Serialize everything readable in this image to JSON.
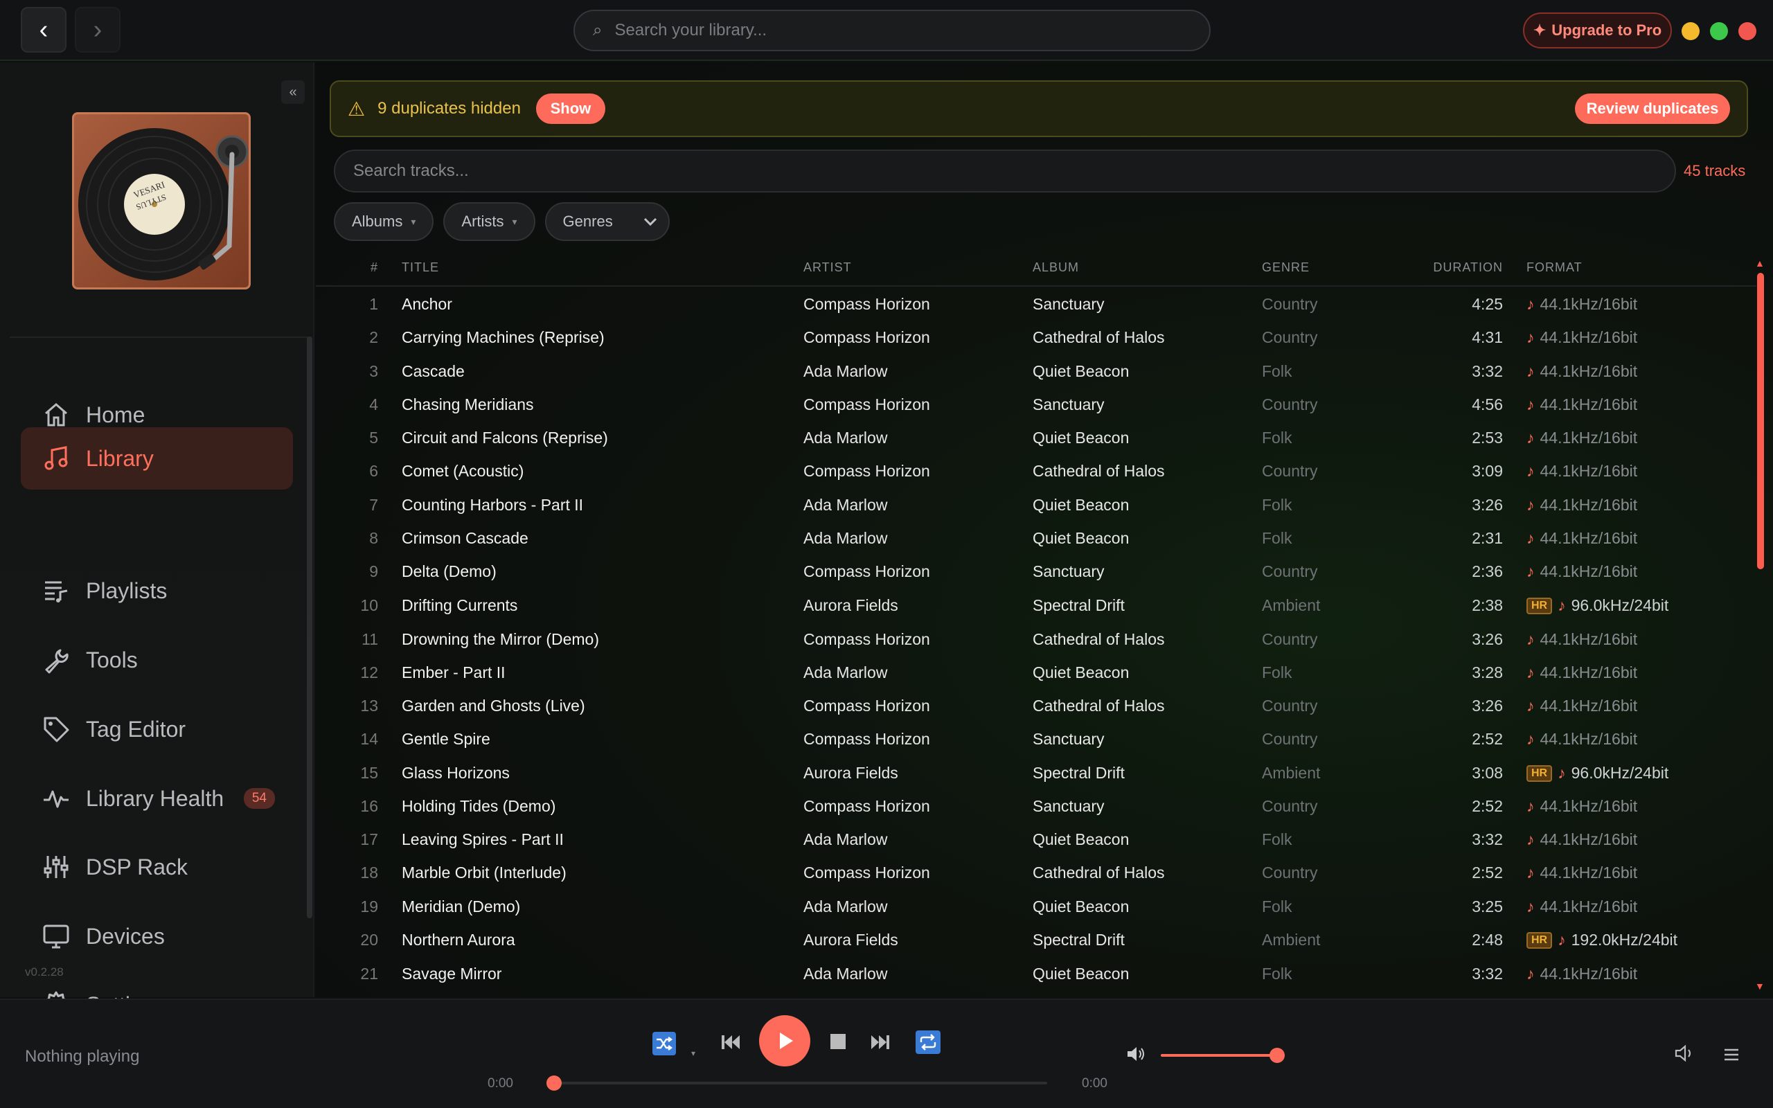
{
  "titlebar": {
    "search_placeholder": "Search your library...",
    "upgrade_label": "Upgrade to Pro"
  },
  "colors": {
    "accent": "#ff6b5b",
    "warning": "#e9c24a",
    "background": "#0e0f10"
  },
  "sidebar": {
    "collapse_label": "«",
    "art_label_top": "VESARI",
    "art_label_bottom": "STYLUS",
    "items": [
      {
        "label": "Home",
        "icon": "home-icon"
      },
      {
        "label": "Library",
        "icon": "music-note-icon",
        "active": true
      },
      {
        "label": "Playlists",
        "icon": "playlist-icon"
      },
      {
        "label": "Tools",
        "icon": "wrench-icon"
      },
      {
        "label": "Tag Editor",
        "icon": "tag-icon"
      },
      {
        "label": "Library Health",
        "icon": "pulse-icon",
        "badge": "54"
      },
      {
        "label": "DSP Rack",
        "icon": "sliders-icon"
      },
      {
        "label": "Devices",
        "icon": "monitor-icon"
      },
      {
        "label": "Settings",
        "icon": "gear-icon"
      }
    ],
    "version": "v0.2.28"
  },
  "duplicates": {
    "message": "9 duplicates hidden",
    "show_label": "Show",
    "review_label": "Review duplicates"
  },
  "tracks_search": {
    "placeholder": "Search tracks...",
    "count": "45 tracks"
  },
  "filters": [
    {
      "label": "Albums"
    },
    {
      "label": "Artists"
    },
    {
      "label": "Genres"
    }
  ],
  "table": {
    "columns": {
      "num": "#",
      "title": "TITLE",
      "artist": "ARTIST",
      "album": "ALBUM",
      "genre": "GENRE",
      "duration": "DURATION",
      "format": "FORMAT"
    },
    "rows": [
      {
        "num": "1",
        "title": "Anchor",
        "artist": "Compass Horizon",
        "album": "Sanctuary",
        "genre": "Country",
        "duration": "4:25",
        "format": "44.1kHz/16bit",
        "hr": false
      },
      {
        "num": "2",
        "title": "Carrying Machines (Reprise)",
        "artist": "Compass Horizon",
        "album": "Cathedral of Halos",
        "genre": "Country",
        "duration": "4:31",
        "format": "44.1kHz/16bit",
        "hr": false
      },
      {
        "num": "3",
        "title": "Cascade",
        "artist": "Ada Marlow",
        "album": "Quiet Beacon",
        "genre": "Folk",
        "duration": "3:32",
        "format": "44.1kHz/16bit",
        "hr": false
      },
      {
        "num": "4",
        "title": "Chasing Meridians",
        "artist": "Compass Horizon",
        "album": "Sanctuary",
        "genre": "Country",
        "duration": "4:56",
        "format": "44.1kHz/16bit",
        "hr": false
      },
      {
        "num": "5",
        "title": "Circuit and Falcons (Reprise)",
        "artist": "Ada Marlow",
        "album": "Quiet Beacon",
        "genre": "Folk",
        "duration": "2:53",
        "format": "44.1kHz/16bit",
        "hr": false
      },
      {
        "num": "6",
        "title": "Comet (Acoustic)",
        "artist": "Compass Horizon",
        "album": "Cathedral of Halos",
        "genre": "Country",
        "duration": "3:09",
        "format": "44.1kHz/16bit",
        "hr": false
      },
      {
        "num": "7",
        "title": "Counting Harbors - Part II",
        "artist": "Ada Marlow",
        "album": "Quiet Beacon",
        "genre": "Folk",
        "duration": "3:26",
        "format": "44.1kHz/16bit",
        "hr": false
      },
      {
        "num": "8",
        "title": "Crimson Cascade",
        "artist": "Ada Marlow",
        "album": "Quiet Beacon",
        "genre": "Folk",
        "duration": "2:31",
        "format": "44.1kHz/16bit",
        "hr": false
      },
      {
        "num": "9",
        "title": "Delta (Demo)",
        "artist": "Compass Horizon",
        "album": "Sanctuary",
        "genre": "Country",
        "duration": "2:36",
        "format": "44.1kHz/16bit",
        "hr": false
      },
      {
        "num": "10",
        "title": "Drifting Currents",
        "artist": "Aurora Fields",
        "album": "Spectral Drift",
        "genre": "Ambient",
        "duration": "2:38",
        "format": "96.0kHz/24bit",
        "hr": true
      },
      {
        "num": "11",
        "title": "Drowning the Mirror (Demo)",
        "artist": "Compass Horizon",
        "album": "Cathedral of Halos",
        "genre": "Country",
        "duration": "3:26",
        "format": "44.1kHz/16bit",
        "hr": false
      },
      {
        "num": "12",
        "title": "Ember - Part II",
        "artist": "Ada Marlow",
        "album": "Quiet Beacon",
        "genre": "Folk",
        "duration": "3:28",
        "format": "44.1kHz/16bit",
        "hr": false
      },
      {
        "num": "13",
        "title": "Garden and Ghosts (Live)",
        "artist": "Compass Horizon",
        "album": "Cathedral of Halos",
        "genre": "Country",
        "duration": "3:26",
        "format": "44.1kHz/16bit",
        "hr": false
      },
      {
        "num": "14",
        "title": "Gentle Spire",
        "artist": "Compass Horizon",
        "album": "Sanctuary",
        "genre": "Country",
        "duration": "2:52",
        "format": "44.1kHz/16bit",
        "hr": false
      },
      {
        "num": "15",
        "title": "Glass Horizons",
        "artist": "Aurora Fields",
        "album": "Spectral Drift",
        "genre": "Ambient",
        "duration": "3:08",
        "format": "96.0kHz/24bit",
        "hr": true
      },
      {
        "num": "16",
        "title": "Holding Tides (Demo)",
        "artist": "Compass Horizon",
        "album": "Sanctuary",
        "genre": "Country",
        "duration": "2:52",
        "format": "44.1kHz/16bit",
        "hr": false
      },
      {
        "num": "17",
        "title": "Leaving Spires - Part II",
        "artist": "Ada Marlow",
        "album": "Quiet Beacon",
        "genre": "Folk",
        "duration": "3:32",
        "format": "44.1kHz/16bit",
        "hr": false
      },
      {
        "num": "18",
        "title": "Marble Orbit (Interlude)",
        "artist": "Compass Horizon",
        "album": "Cathedral of Halos",
        "genre": "Country",
        "duration": "2:52",
        "format": "44.1kHz/16bit",
        "hr": false
      },
      {
        "num": "19",
        "title": "Meridian (Demo)",
        "artist": "Ada Marlow",
        "album": "Quiet Beacon",
        "genre": "Folk",
        "duration": "3:25",
        "format": "44.1kHz/16bit",
        "hr": false
      },
      {
        "num": "20",
        "title": "Northern Aurora",
        "artist": "Aurora Fields",
        "album": "Spectral Drift",
        "genre": "Ambient",
        "duration": "2:48",
        "format": "192.0kHz/24bit",
        "hr": true
      },
      {
        "num": "21",
        "title": "Savage Mirror",
        "artist": "Ada Marlow",
        "album": "Quiet Beacon",
        "genre": "Folk",
        "duration": "3:32",
        "format": "44.1kHz/16bit",
        "hr": false
      }
    ],
    "hr_label": "HR"
  },
  "player": {
    "now_playing": "Nothing playing",
    "time_elapsed": "0:00",
    "time_total": "0:00",
    "progress": 0,
    "volume": 0.95
  }
}
